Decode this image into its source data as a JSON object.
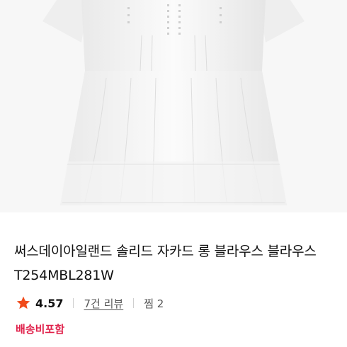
{
  "product": {
    "title": "써스데이아일랜드 솔리드 자카드 롱 블라우스 블라우스 T254MBL281W",
    "rating": "4.57",
    "reviews": "7건 리뷰",
    "wishlist": "찜 2",
    "shipping": "배송비포함",
    "image": "white-blouse-photo"
  },
  "colors": {
    "star": "#f04a1a",
    "shipping": "#e0204a"
  }
}
